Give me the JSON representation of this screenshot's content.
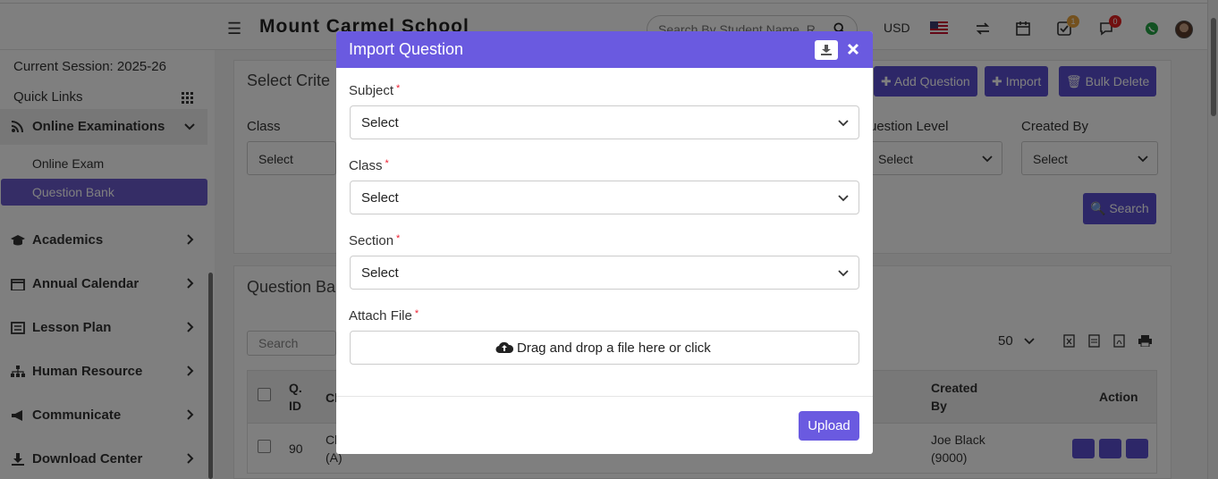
{
  "header": {
    "school_name": "Mount Carmel School",
    "search_placeholder": "Search By Student Name, R",
    "currency": "USD",
    "badge_tasks": "1",
    "badge_chat": "0"
  },
  "sidebar": {
    "session": "Current Session: 2025-26",
    "quick_links": "Quick Links",
    "online_exams": "Online Examinations",
    "online_exam": "Online Exam",
    "question_bank": "Question Bank",
    "academics": "Academics",
    "annual_calendar": "Annual Calendar",
    "lesson_plan": "Lesson Plan",
    "human_resource": "Human Resource",
    "communicate": "Communicate",
    "download_center": "Download Center"
  },
  "criteria": {
    "title": "Select Crite",
    "add_question": "Add Question",
    "import": "Import",
    "bulk_delete": "Bulk Delete",
    "class_label": "Class",
    "class_value": "Select",
    "level_label": "uestion Level",
    "level_value": "Select",
    "created_by_label": "Created By",
    "created_by_value": "Select",
    "search_btn": "Search"
  },
  "question_bank": {
    "title": "Question Ba",
    "search_placeholder": "Search",
    "page_size": "50",
    "col_qid": "Q. ID",
    "col_class_partial": "Cl",
    "col_created_by": "Created By",
    "col_action": "Action",
    "rows": [
      {
        "qid": "90",
        "class_partial": "Cl (A)",
        "created_by": "Joe Black (9000)"
      }
    ]
  },
  "modal": {
    "title": "Import Question",
    "subject_label": "Subject",
    "subject_value": "Select",
    "class_label": "Class",
    "class_value": "Select",
    "section_label": "Section",
    "section_value": "Select",
    "attach_label": "Attach File",
    "required_mark": "*",
    "dropzone_text": "Drag and drop a file here or click",
    "upload_btn": "Upload"
  },
  "colors": {
    "brand_purple": "#6a5ae0",
    "button_purple": "#5b4fd0",
    "required_red": "#e22233"
  }
}
